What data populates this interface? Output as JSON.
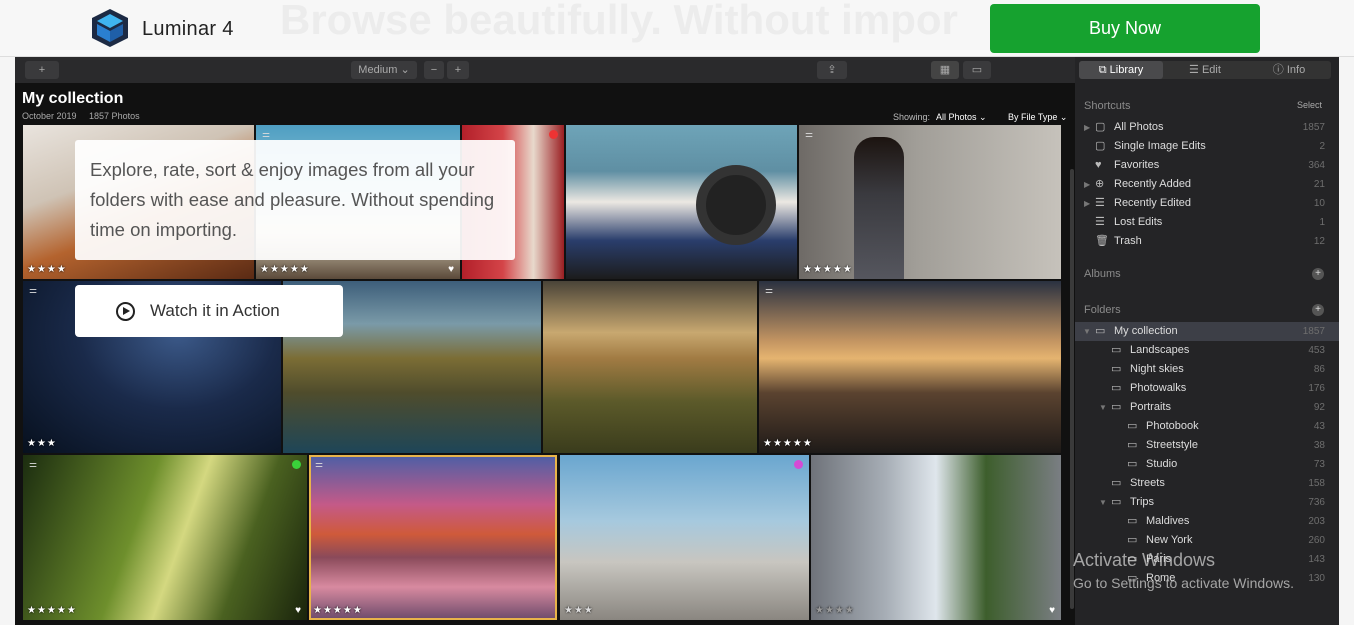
{
  "banner": {
    "brand": "Luminar 4",
    "headline": "Browse beautifully. Without impor",
    "buy_label": "Buy Now",
    "overlay_text": "Explore, rate, sort & enjoy images from all your folders with ease and pleasure. Without spending time on importing.",
    "watch_label": "Watch it in Action"
  },
  "toolbar": {
    "add": "+",
    "size_label": "Medium ⌄",
    "zoom_out": "−",
    "zoom_in": "+",
    "share_icon": "⇪",
    "grid_icon": "▦",
    "single_icon": "▭"
  },
  "panel_tabs": [
    {
      "label": "Library",
      "icon": "library-icon"
    },
    {
      "label": "Edit",
      "icon": "sliders-icon"
    },
    {
      "label": "Info",
      "icon": "info-icon"
    }
  ],
  "sidebar": {
    "shortcuts_header": "Shortcuts",
    "select_label": "Select",
    "shortcuts": [
      {
        "label": "All Photos",
        "count": "1857",
        "icon": "▢"
      },
      {
        "label": "Single Image Edits",
        "count": "2",
        "icon": "▢"
      },
      {
        "label": "Favorites",
        "count": "364",
        "icon": "♥"
      },
      {
        "label": "Recently Added",
        "count": "21",
        "icon": "⊕"
      },
      {
        "label": "Recently Edited",
        "count": "10",
        "icon": "☰"
      },
      {
        "label": "Lost Edits",
        "count": "1",
        "icon": "☰"
      },
      {
        "label": "Trash",
        "count": "12",
        "icon": "🗑"
      }
    ],
    "albums_header": "Albums",
    "folders_header": "Folders",
    "folders": [
      {
        "label": "My collection",
        "count": "1857",
        "level": 0
      },
      {
        "label": "Landscapes",
        "count": "453",
        "level": 1
      },
      {
        "label": "Night skies",
        "count": "86",
        "level": 1
      },
      {
        "label": "Photowalks",
        "count": "176",
        "level": 1
      },
      {
        "label": "Portraits",
        "count": "92",
        "level": 1
      },
      {
        "label": "Photobook",
        "count": "43",
        "level": 2
      },
      {
        "label": "Streetstyle",
        "count": "38",
        "level": 2
      },
      {
        "label": "Studio",
        "count": "73",
        "level": 2
      },
      {
        "label": "Streets",
        "count": "158",
        "level": 1
      },
      {
        "label": "Trips",
        "count": "736",
        "level": 1
      },
      {
        "label": "Maldives",
        "count": "203",
        "level": 2
      },
      {
        "label": "New York",
        "count": "260",
        "level": 2
      },
      {
        "label": "Paris",
        "count": "143",
        "level": 2
      },
      {
        "label": "Rome",
        "count": "130",
        "level": 2
      }
    ]
  },
  "gallery": {
    "title": "My collection",
    "subtitle": "October 2019     1857 Photos",
    "showing_label": "Showing:",
    "showing_value": "All Photos ⌄",
    "filetype": "By File Type ⌄",
    "photos": [
      {
        "stars": "★★★★",
        "heart": "",
        "edited": false
      },
      {
        "stars": "★★★★★",
        "heart": "♥",
        "edited": true
      },
      {
        "stars": "",
        "heart": "",
        "edited": false
      },
      {
        "stars": "",
        "heart": "",
        "edited": false
      },
      {
        "stars": "★★★★★",
        "heart": "",
        "edited": true
      },
      {
        "stars": "★★★",
        "heart": "",
        "edited": true
      },
      {
        "stars": "",
        "heart": "",
        "edited": false
      },
      {
        "stars": "",
        "heart": "",
        "edited": false
      },
      {
        "stars": "★★★★★",
        "heart": "",
        "edited": true
      },
      {
        "stars": "★★★★★",
        "heart": "♥",
        "edited": true
      },
      {
        "stars": "★★★★★",
        "heart": "",
        "edited": true
      },
      {
        "stars": "★★★",
        "heart": "",
        "edited": false
      },
      {
        "stars": "★★★★",
        "heart": "♥",
        "edited": false
      }
    ]
  },
  "watermark": {
    "line1": "Activate Windows",
    "line2": "Go to Settings to activate Windows."
  }
}
